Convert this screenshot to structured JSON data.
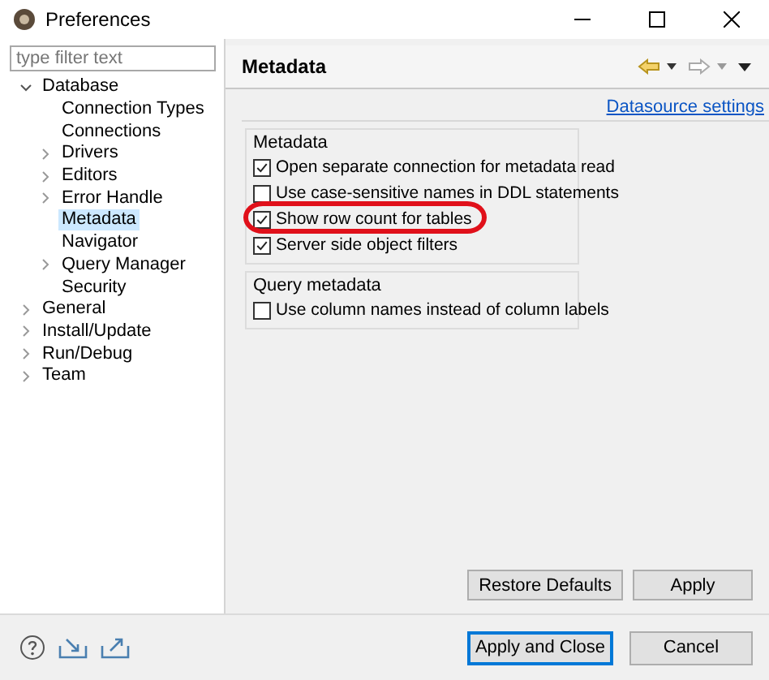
{
  "window": {
    "title": "Preferences"
  },
  "filter": {
    "placeholder": "type filter text"
  },
  "tree": [
    {
      "label": "Database",
      "expanded": true,
      "selected": false,
      "children": [
        {
          "label": "Connection Types",
          "selected": false
        },
        {
          "label": "Connections",
          "selected": false
        },
        {
          "label": "Drivers",
          "expanded": false,
          "selected": false
        },
        {
          "label": "Editors",
          "expanded": false,
          "selected": false
        },
        {
          "label": "Error Handle",
          "expanded": false,
          "selected": false
        },
        {
          "label": "Metadata",
          "selected": true
        },
        {
          "label": "Navigator",
          "selected": false
        },
        {
          "label": "Query Manager",
          "expanded": false,
          "selected": false
        },
        {
          "label": "Security",
          "selected": false
        }
      ]
    },
    {
      "label": "General",
      "expanded": false,
      "selected": false
    },
    {
      "label": "Install/Update",
      "expanded": false,
      "selected": false
    },
    {
      "label": "Run/Debug",
      "expanded": false,
      "selected": false
    },
    {
      "label": "Team",
      "expanded": false,
      "selected": false
    }
  ],
  "page": {
    "title": "Metadata",
    "link": "Datasource settings",
    "groups": [
      {
        "title": "Metadata",
        "options": [
          {
            "label": "Open separate connection for metadata read",
            "checked": true,
            "highlighted": false
          },
          {
            "label": "Use case-sensitive names in DDL statements",
            "checked": false,
            "highlighted": false
          },
          {
            "label": "Show row count for tables",
            "checked": true,
            "highlighted": true
          },
          {
            "label": "Server side object filters",
            "checked": true,
            "highlighted": false
          }
        ]
      },
      {
        "title": "Query metadata",
        "options": [
          {
            "label": "Use column names instead of column labels",
            "checked": false,
            "highlighted": false
          }
        ]
      }
    ],
    "buttons": [
      "Restore Defaults",
      "Apply"
    ]
  },
  "footer": {
    "buttons": [
      {
        "label": "Apply and Close",
        "default": true
      },
      {
        "label": "Cancel",
        "default": false
      }
    ]
  }
}
